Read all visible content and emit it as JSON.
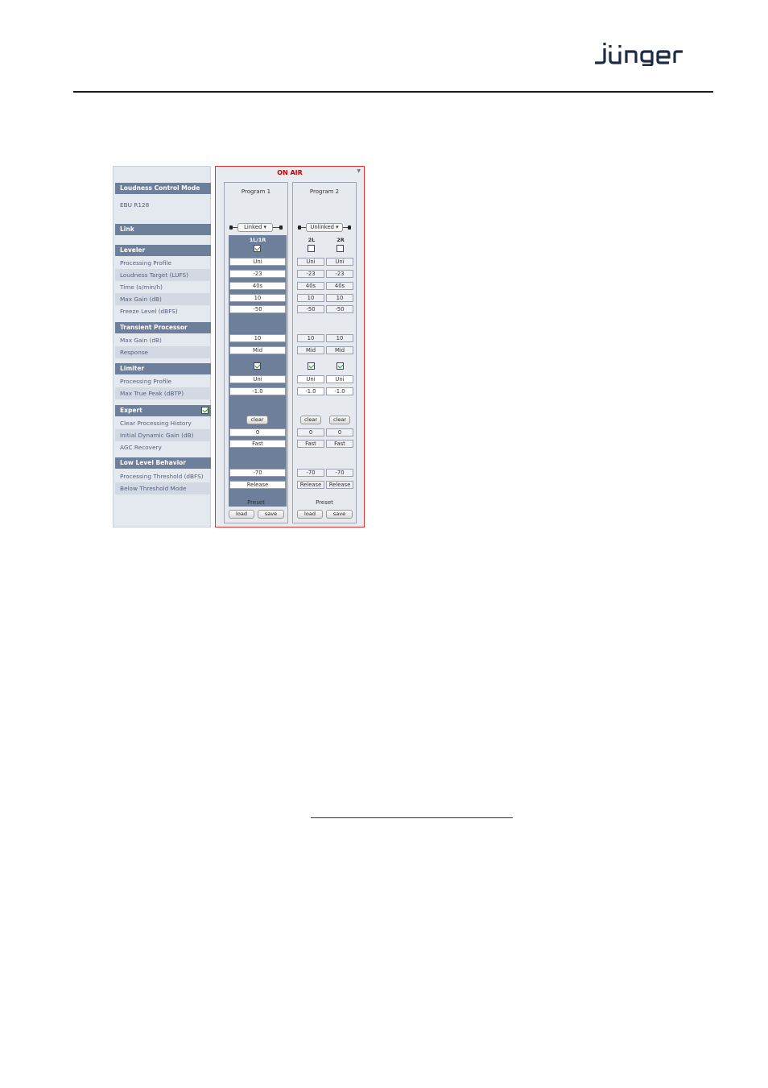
{
  "brand": {
    "name": "jünger"
  },
  "labels": {
    "loudness_control_mode": "Loudness Control Mode",
    "mode_value": "EBU R128",
    "link": "Link",
    "leveler": "Leveler",
    "processing_profile": "Processing Profile",
    "loudness_target": "Loudness Target (LUFS)",
    "time": "Time (s/min/h)",
    "max_gain": "Max Gain (dB)",
    "freeze_level": "Freeze Level (dBFS)",
    "transient_processor": "Transient Processor",
    "tp_max_gain": "Max Gain (dB)",
    "response": "Response",
    "limiter": "Limiter",
    "lim_processing_profile": "Processing Profile",
    "max_true_peak": "Max True Peak (dBTP)",
    "expert": "Expert",
    "clear_processing_history": "Clear Processing History",
    "initial_dynamic_gain": "Initial Dynamic Gain (dB)",
    "agc_recovery": "AGC Recovery",
    "low_level_behavior": "Low Level Behavior",
    "processing_threshold": "Processing Threshold (dBFS)",
    "below_threshold_mode": "Below Threshold Mode"
  },
  "status": {
    "on_air": "ON AIR"
  },
  "program1": {
    "title": "Program 1",
    "link": "Linked",
    "channel": "1L/1R",
    "leveler_on": true,
    "profile": "Uni",
    "target": "-23",
    "time": "40s",
    "max_gain": "10",
    "freeze": "-50",
    "tp_max_gain": "10",
    "response": "Mid",
    "limiter_on": true,
    "lim_profile": "Uni",
    "true_peak": "-1.0",
    "clear": "clear",
    "init_gain": "0",
    "agc": "Fast",
    "threshold": "-70",
    "below": "Release",
    "preset": "Preset",
    "load": "load",
    "save": "save"
  },
  "program2": {
    "title": "Program 2",
    "link": "Unlinked",
    "ch_left": "2L",
    "ch_right": "2R",
    "left": {
      "leveler_on": false,
      "profile": "Uni",
      "target": "-23",
      "time": "40s",
      "max_gain": "10",
      "freeze": "-50",
      "tp_max_gain": "10",
      "response": "Mid",
      "limiter_on": true,
      "lim_profile": "Uni",
      "true_peak": "-1.0",
      "clear": "clear",
      "init_gain": "0",
      "agc": "Fast",
      "threshold": "-70",
      "below": "Release"
    },
    "right": {
      "leveler_on": false,
      "profile": "Uni",
      "target": "-23",
      "time": "40s",
      "max_gain": "10",
      "freeze": "-50",
      "tp_max_gain": "10",
      "response": "Mid",
      "limiter_on": true,
      "lim_profile": "Uni",
      "true_peak": "-1.0",
      "clear": "clear",
      "init_gain": "0",
      "agc": "Fast",
      "threshold": "-70",
      "below": "Release"
    },
    "preset": "Preset",
    "load": "load",
    "save": "save"
  },
  "colors": {
    "accent": "#6e7f9b",
    "on_air": "#cc0000",
    "link": "#1a1aee"
  }
}
